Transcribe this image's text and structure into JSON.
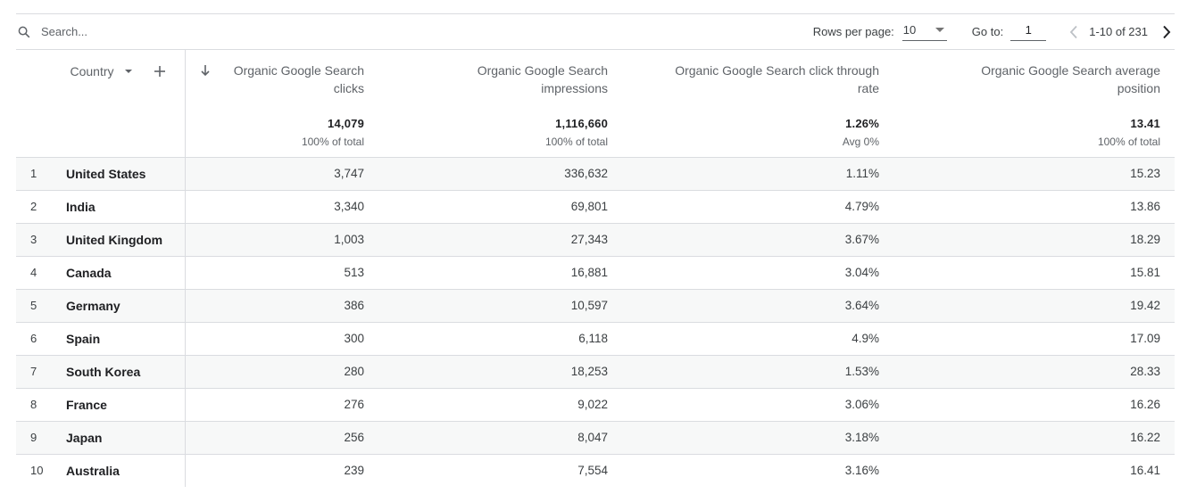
{
  "toolbar": {
    "search_placeholder": "Search...",
    "search_icon": "search-icon",
    "rows_per_page_label": "Rows per page:",
    "rows_per_page_value": "10",
    "goto_label": "Go to:",
    "goto_value": "1",
    "range_text": "1-10 of 231",
    "prev_icon": "chevron-left-icon",
    "next_icon": "chevron-right-icon"
  },
  "table": {
    "dimension_header": "Country",
    "columns": [
      {
        "title": "Organic Google Search clicks",
        "total": "14,079",
        "sub": "100% of total",
        "sorted": "desc"
      },
      {
        "title": "Organic Google Search impressions",
        "total": "1,116,660",
        "sub": "100% of total"
      },
      {
        "title": "Organic Google Search click through rate",
        "total": "1.26%",
        "sub": "Avg 0%"
      },
      {
        "title": "Organic Google Search average position",
        "total": "13.41",
        "sub": "100% of total"
      }
    ],
    "rows": [
      {
        "n": "1",
        "country": "United States",
        "clicks": "3,747",
        "impressions": "336,632",
        "ctr": "1.11%",
        "position": "15.23"
      },
      {
        "n": "2",
        "country": "India",
        "clicks": "3,340",
        "impressions": "69,801",
        "ctr": "4.79%",
        "position": "13.86"
      },
      {
        "n": "3",
        "country": "United Kingdom",
        "clicks": "1,003",
        "impressions": "27,343",
        "ctr": "3.67%",
        "position": "18.29"
      },
      {
        "n": "4",
        "country": "Canada",
        "clicks": "513",
        "impressions": "16,881",
        "ctr": "3.04%",
        "position": "15.81"
      },
      {
        "n": "5",
        "country": "Germany",
        "clicks": "386",
        "impressions": "10,597",
        "ctr": "3.64%",
        "position": "19.42"
      },
      {
        "n": "6",
        "country": "Spain",
        "clicks": "300",
        "impressions": "6,118",
        "ctr": "4.9%",
        "position": "17.09"
      },
      {
        "n": "7",
        "country": "South Korea",
        "clicks": "280",
        "impressions": "18,253",
        "ctr": "1.53%",
        "position": "28.33"
      },
      {
        "n": "8",
        "country": "France",
        "clicks": "276",
        "impressions": "9,022",
        "ctr": "3.06%",
        "position": "16.26"
      },
      {
        "n": "9",
        "country": "Japan",
        "clicks": "256",
        "impressions": "8,047",
        "ctr": "3.18%",
        "position": "16.22"
      },
      {
        "n": "10",
        "country": "Australia",
        "clicks": "239",
        "impressions": "7,554",
        "ctr": "3.16%",
        "position": "16.41"
      }
    ]
  }
}
